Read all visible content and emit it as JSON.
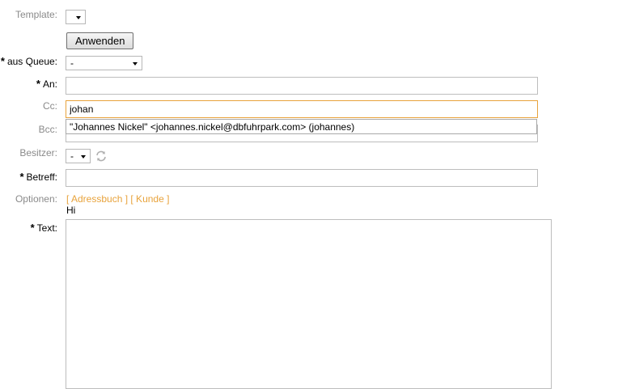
{
  "labels": {
    "template": "Template:",
    "queue": "aus Queue:",
    "an": "An:",
    "cc": "Cc:",
    "bcc": "Bcc:",
    "owner": "Besitzer:",
    "subject": "Betreff:",
    "options": "Optionen:",
    "text": "Text:"
  },
  "required_marker": "*",
  "apply_button": "Anwenden",
  "queue_select": {
    "value": "-"
  },
  "owner_select": {
    "value": "-"
  },
  "fields": {
    "an": "",
    "cc": "johan",
    "bcc": "",
    "subject": ""
  },
  "autocomplete": {
    "suggestion": "\"Johannes Nickel\" <johannes.nickel@dbfuhrpark.com> (johannes)"
  },
  "options": {
    "address_book": "[ Adressbuch ]",
    "customer": "[ Kunde ]"
  },
  "body_text": "Hi",
  "icons": {
    "refresh": "refresh-icon"
  },
  "colors": {
    "link": "#e8a33c",
    "focus_border": "#e8a33c"
  }
}
